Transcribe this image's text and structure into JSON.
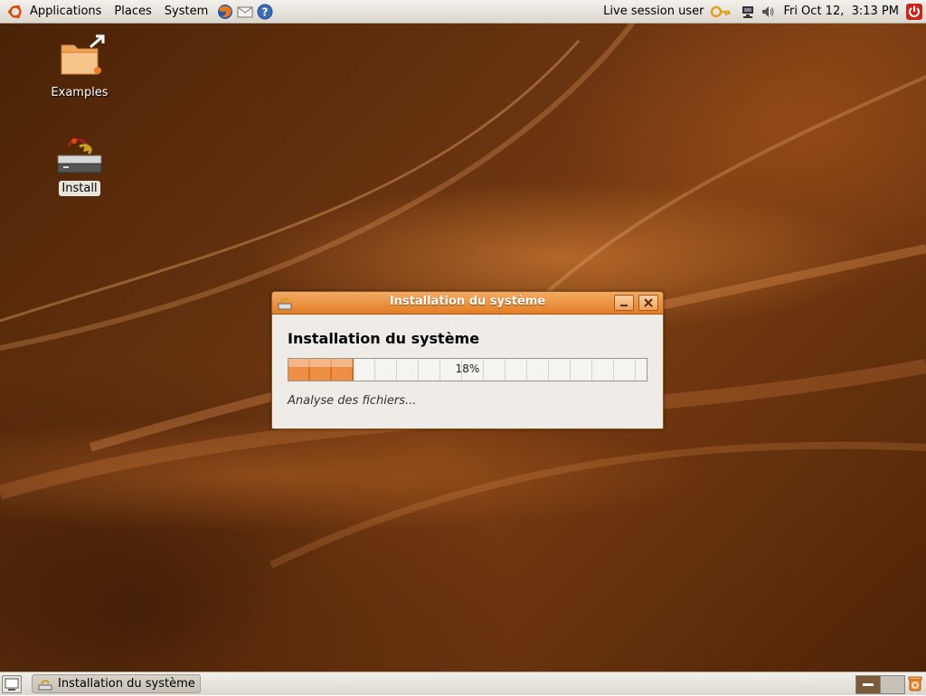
{
  "top_panel": {
    "menus": [
      "Applications",
      "Places",
      "System"
    ],
    "launchers": [
      "firefox-icon",
      "mail-icon",
      "help-icon"
    ],
    "user_label": "Live session user",
    "datetime": "Fri Oct 12,  3:13 PM"
  },
  "desktop": {
    "icons": [
      {
        "label": "Examples",
        "icon": "folder-icon"
      },
      {
        "label": "Install",
        "icon": "install-icon"
      }
    ]
  },
  "dialog": {
    "title": "Installation du système",
    "heading": "Installation du système",
    "progress_percent": 18,
    "progress_text": "18%",
    "status": "Analyse des fichiers..."
  },
  "bottom_panel": {
    "task_label": "Installation du système"
  },
  "colors": {
    "accent": "#e27d26",
    "panel": "#dcd8cf",
    "wallpaper": "#5a2a0a"
  }
}
